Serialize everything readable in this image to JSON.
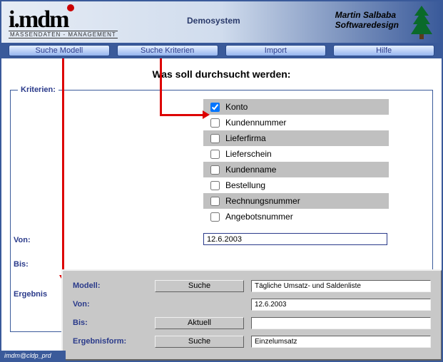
{
  "header": {
    "logo_text": "i.mdm",
    "logo_sub": "MASSENDATEN - MANAGEMENT",
    "center_label": "Demosystem",
    "company_name": "Martin Salbaba",
    "company_sub": "Softwaredesign"
  },
  "nav": {
    "items": [
      "Suche Modell",
      "Suche Kriterien",
      "Import",
      "Hilfe"
    ]
  },
  "main": {
    "title": "Was soll durchsucht werden:",
    "fieldset_legend": "Kriterien:",
    "criteria": [
      {
        "label": "Konto",
        "checked": true,
        "shaded": true
      },
      {
        "label": "Kundennummer",
        "checked": false,
        "shaded": false
      },
      {
        "label": "Lieferfirma",
        "checked": false,
        "shaded": true
      },
      {
        "label": "Lieferschein",
        "checked": false,
        "shaded": false
      },
      {
        "label": "Kundenname",
        "checked": false,
        "shaded": true
      },
      {
        "label": "Bestellung",
        "checked": false,
        "shaded": false
      },
      {
        "label": "Rechnungsnummer",
        "checked": false,
        "shaded": true
      },
      {
        "label": "Angebotsnummer",
        "checked": false,
        "shaded": false
      }
    ],
    "von_label": "Von:",
    "bis_label": "Bis:",
    "erg_label": "Ergebnis",
    "von_value": "12.6.2003"
  },
  "panel2": {
    "modell_label": "Modell:",
    "modell_btn": "Suche",
    "modell_value": "Tägliche Umsatz- und Saldenliste",
    "von_label": "Von:",
    "von_value": "12.6.2003",
    "bis_label": "Bis:",
    "bis_btn": "Aktuell",
    "bis_value": "",
    "erg_label": "Ergebnisform:",
    "erg_btn": "Suche",
    "erg_value": "Einzelumsatz"
  },
  "status_text": "imdm@cldp_prd"
}
